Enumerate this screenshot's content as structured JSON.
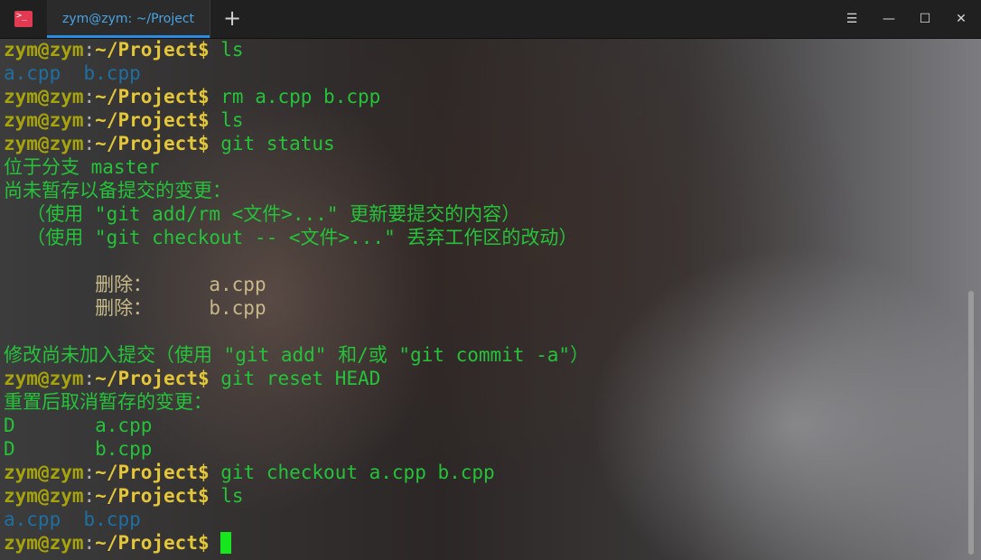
{
  "titlebar": {
    "app_icon_glyph": ">_",
    "tab_title": "zym@zym: ~/Project",
    "new_tab_glyph": "+",
    "menu_glyph": "☰",
    "minimize_glyph": "—",
    "maximize_glyph": "☐",
    "close_glyph": "✕"
  },
  "prompt": {
    "user": "zym@zym",
    "colon": ":",
    "path": "~/Project",
    "dollar": "$"
  },
  "lines": [
    {
      "type": "prompt",
      "cmd": " ls"
    },
    {
      "type": "files",
      "a": "a.cpp",
      "b": "b.cpp"
    },
    {
      "type": "prompt",
      "cmd": " rm a.cpp b.cpp"
    },
    {
      "type": "prompt",
      "cmd": " ls"
    },
    {
      "type": "prompt",
      "cmd": " git status"
    },
    {
      "type": "text",
      "text": "位于分支 master"
    },
    {
      "type": "text",
      "text": "尚未暂存以备提交的变更："
    },
    {
      "type": "text",
      "text": "  （使用 \"git add/rm <文件>...\" 更新要提交的内容）"
    },
    {
      "type": "text",
      "text": "  （使用 \"git checkout -- <文件>...\" 丢弃工作区的改动）"
    },
    {
      "type": "blank"
    },
    {
      "type": "deleted",
      "label": "        删除：",
      "file": "     a.cpp"
    },
    {
      "type": "deleted",
      "label": "        删除：",
      "file": "     b.cpp"
    },
    {
      "type": "blank"
    },
    {
      "type": "text",
      "text": "修改尚未加入提交（使用 \"git add\" 和/或 \"git commit -a\"）"
    },
    {
      "type": "prompt",
      "cmd": " git reset HEAD"
    },
    {
      "type": "text",
      "text": "重置后取消暂存的变更："
    },
    {
      "type": "text",
      "text": "D       a.cpp"
    },
    {
      "type": "text",
      "text": "D       b.cpp"
    },
    {
      "type": "prompt",
      "cmd": " git checkout a.cpp b.cpp"
    },
    {
      "type": "prompt",
      "cmd": " ls"
    },
    {
      "type": "files",
      "a": "a.cpp",
      "b": "b.cpp"
    },
    {
      "type": "prompt_cursor",
      "cmd": " "
    }
  ],
  "colors": {
    "accent_tab": "#4aa3e4",
    "terminal_green": "#25c23a",
    "file_blue": "#1f6fa3",
    "path_yellow": "#e3c63a",
    "cursor": "#17e51d"
  }
}
